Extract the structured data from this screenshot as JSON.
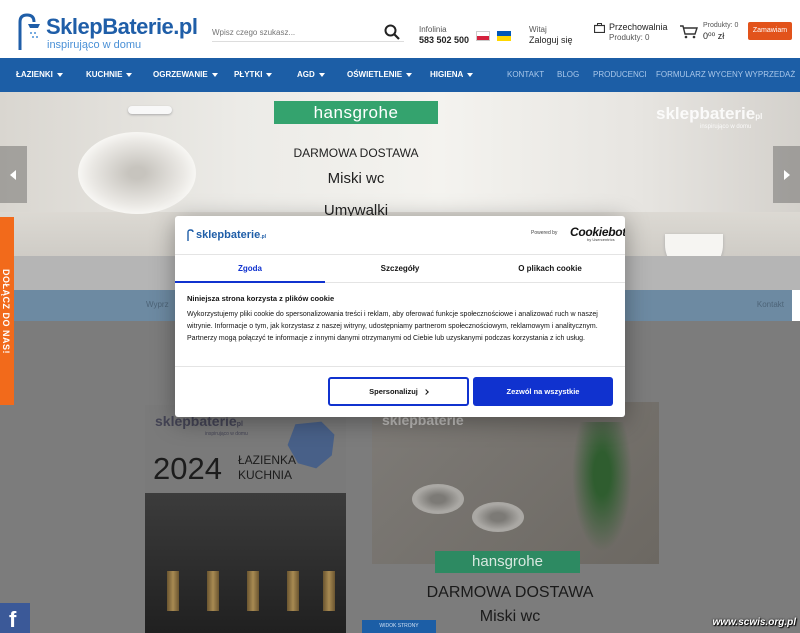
{
  "header": {
    "logo_title": "SklepBaterie.pl",
    "logo_sub": "inspirująco w domu",
    "search_placeholder": "Wpisz czego szukasz...",
    "infolinia_label": "Infolinia",
    "infolinia_phone": "583 502 500",
    "account_greeting": "Witaj",
    "account_login": "Zaloguj się",
    "storage_title": "Przechowalnia",
    "storage_count": "Produkty: 0",
    "cart_count": "Produkty: 0",
    "cart_total": "0⁰⁰ zł",
    "order_button": "Zamawiam"
  },
  "nav": {
    "categories": [
      "ŁAZIENKI",
      "KUCHNIE",
      "OGRZEWANIE",
      "PŁYTKI",
      "AGD",
      "OŚWIETLENIE",
      "HIGIENA"
    ],
    "links": [
      "KONTAKT",
      "BLOG",
      "PRODUCENCI",
      "FORMULARZ WYCENY",
      "WYPRZEDAŻ"
    ]
  },
  "banner": {
    "brand": "hansgrohe",
    "line1": "DARMOWA DOSTAWA",
    "line2": "Miski wc",
    "line3": "Umywalki",
    "watermark": "sklepbaterie",
    "watermark_suffix": "pl",
    "watermark_sub": "inspirująco w domu"
  },
  "subbar": {
    "left_text": "Wyprz",
    "right_text": "Kontakt"
  },
  "promo_cards": {
    "left_logo": "sklepbaterie",
    "left_logo_suffix": "pl",
    "left_sub": "inspirująco w domu",
    "left_year": "2024",
    "left_line1": "ŁAZIENKA",
    "left_line2": "KUCHNIA",
    "right_logo": "sklepbaterie",
    "right_brand": "hansgrohe",
    "right_line1": "DARMOWA DOSTAWA",
    "right_line2": "Miski wc",
    "small_button": "WIDOK STRONY"
  },
  "side": {
    "join_tab": "DOŁĄCZ DO NAS!",
    "facebook": "f",
    "watermark": "www.scwis.org.pl"
  },
  "cookie_dialog": {
    "logo": "sklepbaterie",
    "logo_suffix": ".pl",
    "powered_by": "Powered by",
    "cookiebot": "Cookiebot",
    "cookiebot_sub": "by Usercentrics",
    "tabs": [
      "Zgoda",
      "Szczegóły",
      "O plikach cookie"
    ],
    "active_tab": "Zgoda",
    "heading": "Niniejsza strona korzysta z plików cookie",
    "body": "Wykorzystujemy pliki cookie do spersonalizowania treści i reklam, aby oferować funkcje społecznościowe i analizować ruch w naszej witrynie. Informacje o tym, jak korzystasz z naszej witryny, udostępniamy partnerom społecznościowym, reklamowym i analitycznym. Partnerzy mogą połączyć te informacje z innymi danymi otrzymanymi od Ciebie lub uzyskanymi podczas korzystania z ich usług.",
    "btn_personalize": "Spersonalizuj",
    "btn_allow": "Zezwól na wszystkie"
  },
  "colors": {
    "brand_blue": "#1c5ea6",
    "cookie_blue": "#1032cf",
    "accent_orange": "#f26a1b",
    "hansgrohe_green": "#34a36e"
  }
}
